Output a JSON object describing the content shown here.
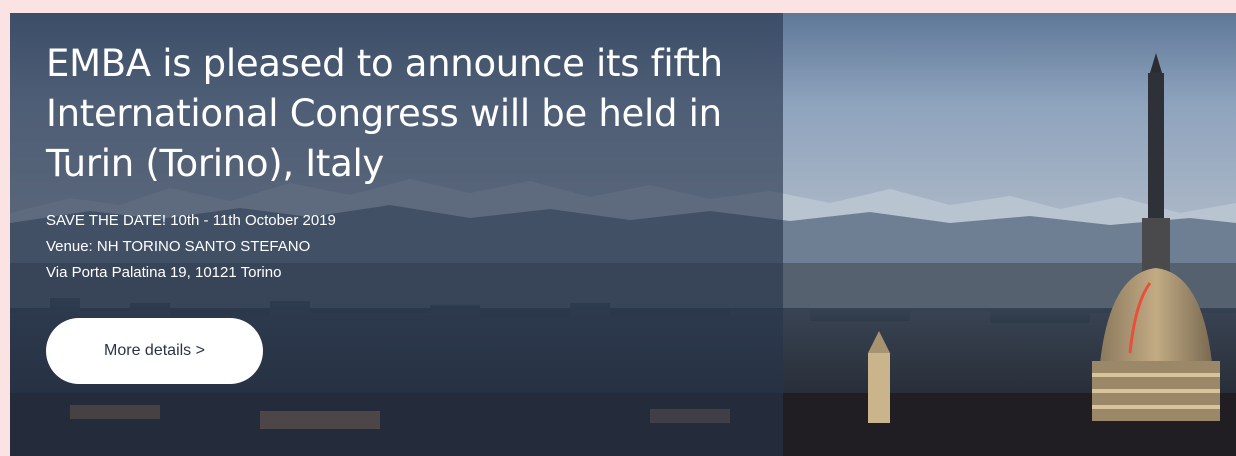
{
  "banner": {
    "headline": "EMBA is pleased to announce its fifth International Congress will be held in Turin (Torino), Italy",
    "date_line": "SAVE THE DATE! 10th - 11th October 2019",
    "venue_line": "Venue: NH TORINO SANTO STEFANO",
    "address_line": "Via Porta Palatina 19, 10121 Torino",
    "button_label": "More details >"
  },
  "colors": {
    "page_background": "#fbe3e4",
    "overlay_panel": "#26344a",
    "button_background": "#ffffff",
    "button_text": "#2a3447"
  }
}
